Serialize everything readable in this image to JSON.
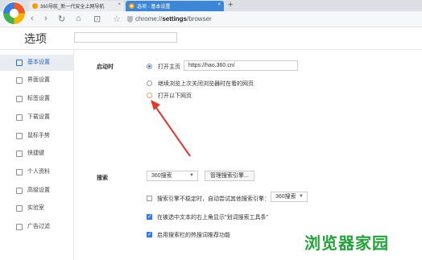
{
  "tabs": [
    {
      "title": "360导航_新一代安全上网导航",
      "active": false
    },
    {
      "title": "选项 - 基本设置",
      "active": true
    }
  ],
  "new_tab_symbol": "+",
  "tab_close_symbol": "×",
  "toolbar": {
    "back": "‹",
    "forward": "›",
    "reload": "↻",
    "home": "⌂",
    "restore": "⊡",
    "favorite": "☆"
  },
  "address_bar": {
    "scheme": "chrome://",
    "path": "settings",
    "rest": "/browser"
  },
  "page": {
    "title": "选项",
    "search_placeholder": ""
  },
  "sidebar": {
    "items": [
      {
        "label": "基本设置",
        "icon": "gear-icon",
        "active": true
      },
      {
        "label": "界面设置",
        "icon": "window-icon",
        "active": false
      },
      {
        "label": "标签设置",
        "icon": "tab-icon",
        "active": false
      },
      {
        "label": "下载设置",
        "icon": "download-icon",
        "active": false
      },
      {
        "label": "鼠标手势",
        "icon": "mouse-icon",
        "active": false
      },
      {
        "label": "快捷键",
        "icon": "keyboard-icon",
        "active": false
      },
      {
        "label": "个人资料",
        "icon": "user-icon",
        "active": false
      },
      {
        "label": "高级设置",
        "icon": "sliders-icon",
        "active": false
      },
      {
        "label": "实验室",
        "icon": "flask-icon",
        "active": false
      },
      {
        "label": "广告过滤",
        "icon": "block-icon",
        "active": false
      }
    ]
  },
  "startup": {
    "section_label": "启动时",
    "open_homepage_label": "打开主页",
    "homepage_url": "https://hao.360.cn/",
    "continue_label": "继续浏览上次关闭浏览器时在看的网页",
    "open_pages_label": "打开以下网页",
    "selected": "open_homepage"
  },
  "search": {
    "section_label": "搜索",
    "engine_value": "360搜索",
    "manage_button": "管理搜索引擎...",
    "fallback_label": "搜索引擎不稳定时，自动尝试其他搜索引擎：",
    "fallback_engine_value": "360搜索",
    "fallback_checked": false,
    "show_toolbar_label": "在被选中文本的右上角显示\"划词搜索工具条\"",
    "show_toolbar_checked": true,
    "suggest_label": "启用搜索栏的热搜词推荐功能",
    "suggest_checked": true
  },
  "watermark": "浏览器家园",
  "colors": {
    "accent": "#3a7be0",
    "active_tab": "#3b86d6",
    "arrow": "#e2392f",
    "watermark": "#25a13c"
  }
}
